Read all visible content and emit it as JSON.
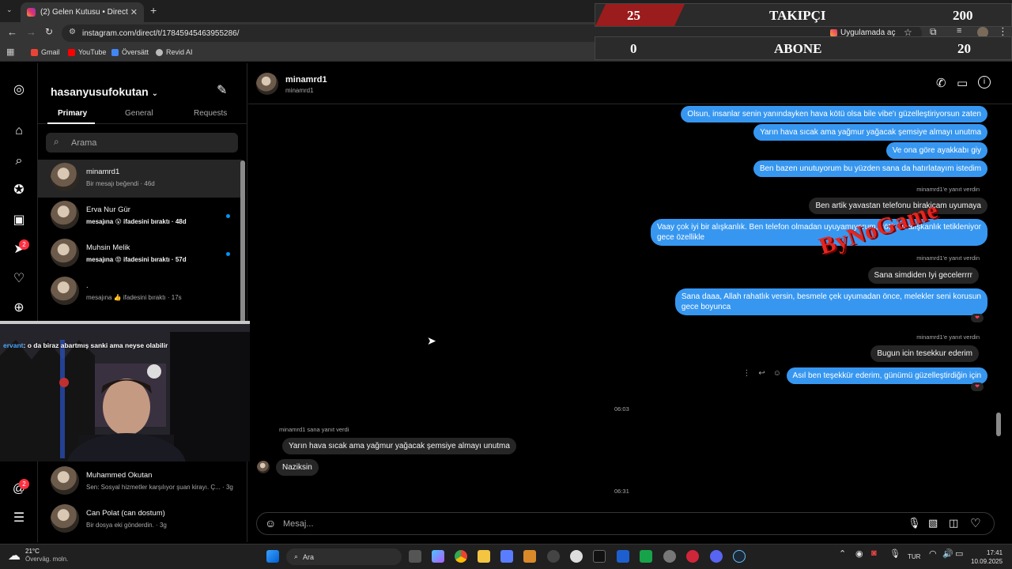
{
  "browser": {
    "tab_title": "(2) Gelen Kutusu • Direct",
    "url": "instagram.com/direct/t/17845945463955286/",
    "open_in_app": "Uygulamada aç",
    "bookmarks": [
      "Gmail",
      "YouTube",
      "Översätt",
      "Revid AI"
    ]
  },
  "overlay": {
    "row1": {
      "left": "25",
      "label": "TAKIPÇI",
      "right": "200"
    },
    "row2": {
      "left": "0",
      "label": "ABONE",
      "right": "20"
    },
    "watermark": "ByNoGame"
  },
  "sidebar": {
    "username": "hasanyusufokutan",
    "tabs": [
      "Primary",
      "General",
      "Requests"
    ],
    "search_placeholder": "Arama",
    "messages_badge": "2",
    "threads_badge": "2",
    "conversations": [
      {
        "name": "minamrd1",
        "preview": "Bir mesajı beğendi · 46d"
      },
      {
        "name": "Erva Nur Gür",
        "preview": "mesajına 😮 ifadesini bıraktı · 48d"
      },
      {
        "name": "Muhsin Melik",
        "preview": "mesajına 😡 ifadesini bıraktı · 57d"
      },
      {
        "name": ".",
        "preview": "mesajına 👍 ifadesini bıraktı · 17s"
      },
      {
        "name": "Muhammed Okutan",
        "preview": "Sen: Sosyal hizmetler karşılıyor şuan kirayı. Ç... · 3g"
      },
      {
        "name": "Can Polat (can dostum)",
        "preview": "Bir dosya eki gönderdin. · 3g"
      }
    ]
  },
  "stream_chat": {
    "user": "ervant",
    "text": ": o da biraz abartmış sanki ama neyse olabilir"
  },
  "chat": {
    "name": "minamrd1",
    "handle": "minamrd1",
    "composer_placeholder": "Mesaj...",
    "reply_note_1": "minamrd1'e yanıt verdin",
    "reply_note_2": "minamrd1'e yanıt verdin",
    "reply_note_3": "minamrd1'e yanıt verdin",
    "reply_note_4": "minamrd1 sana yanıt verdi",
    "m1": "Olsun, insanlar senin yanındayken hava kötü olsa bile vibe'ı güzelleştiriyorsun zaten",
    "m2": "Yarın hava sıcak ama yağmur yağacak şemsiye almayı unutma",
    "m3": "Ve ona göre ayakkabı giy",
    "m4": "Ben bazen unutuyorum bu yüzden sana da hatırlatayım istedim",
    "q1": "Ben artik yavastan telefonu birakicam uyumaya",
    "m5a": "Vaay çok iyi bir alışkanlık. Ben telefon olmadan uyuyamıyorum, kötü bir alışkanlık tetikleniyor",
    "m5b": "gece özellikle",
    "q2": "Sana simdiden Iyi gecelerrrr",
    "m6a": "Sana daaa, Allah rahatlık versin, besmele çek uyumadan önce, melekler seni korusun",
    "m6b": "gece boyunca",
    "q3": "Bugun icin tesekkur ederim",
    "m7": "Asıl ben teşekkür ederim, günümü güzelleştirdiğin için",
    "time1": "06:03",
    "quoted": "Yarın hava sıcak ama yağmur yağacak şemsiye almayı unutma",
    "them1": "Naziksin",
    "time2": "06:31"
  },
  "taskbar": {
    "weather_temp": "21°C",
    "weather_desc": "Övervāg. moln.",
    "search": "Ara",
    "lang": "TUR",
    "time": "17:41",
    "date": "10.09.2025"
  }
}
